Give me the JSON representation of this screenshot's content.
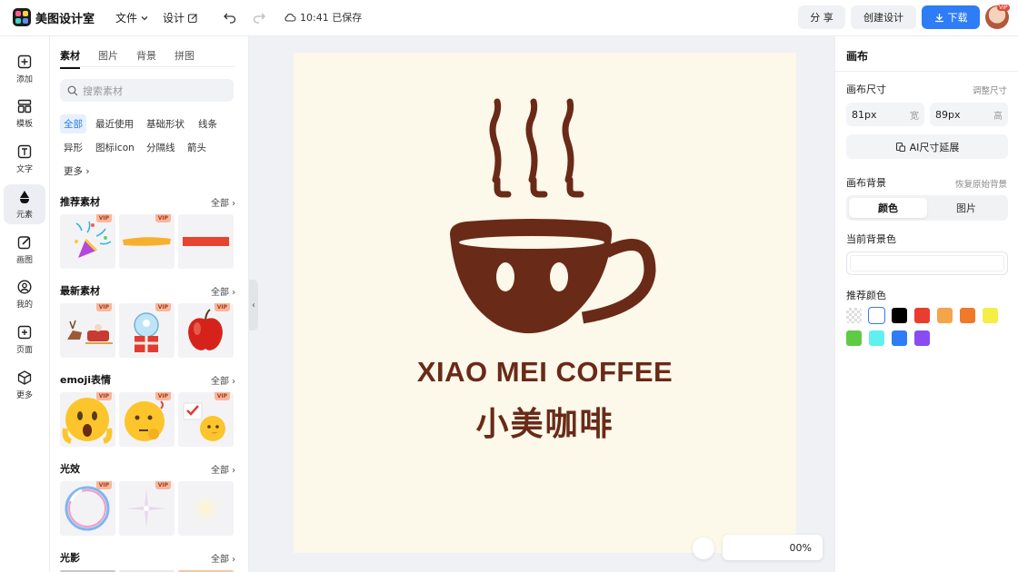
{
  "app": {
    "name": "美图设计室"
  },
  "topbar": {
    "file_menu": "文件",
    "design_menu": "设计",
    "save_status": "10:41 已保存",
    "share_label": "分 享",
    "create_label": "创建设计",
    "download_label": "下载",
    "avatar_badge": "VIP"
  },
  "rail": {
    "items": [
      {
        "label": "添加",
        "icon": "plus-square-icon"
      },
      {
        "label": "模板",
        "icon": "template-icon"
      },
      {
        "label": "文字",
        "icon": "text-icon"
      },
      {
        "label": "元素",
        "icon": "shapes-icon"
      },
      {
        "label": "画图",
        "icon": "pencil-icon"
      },
      {
        "label": "我的",
        "icon": "user-icon"
      },
      {
        "label": "页面",
        "icon": "page-add-icon"
      },
      {
        "label": "更多",
        "icon": "cube-icon"
      }
    ],
    "active": "元素"
  },
  "panel": {
    "tabs": [
      "素材",
      "图片",
      "背景",
      "拼图"
    ],
    "active_tab": "素材",
    "search_placeholder": "搜索素材",
    "chips": [
      "全部",
      "最近使用",
      "基础形状",
      "线条",
      "异形",
      "图标icon",
      "分隔线",
      "箭头",
      "更多"
    ],
    "vip_label": "VIP",
    "all_label": "全部",
    "sections": [
      {
        "title": "推荐素材",
        "items": [
          "party-popper",
          "yellow-brush-stroke",
          "red-bar"
        ]
      },
      {
        "title": "最新素材",
        "items": [
          "reindeer-sleigh",
          "snow-globe-gift",
          "red-apple"
        ]
      },
      {
        "title": "emoji表情",
        "items": [
          "shocked-emoji",
          "thinking-emoji",
          "chick-emoji"
        ]
      },
      {
        "title": "光效",
        "items": [
          "bubble-ring",
          "star-sparkle",
          "soft-glow"
        ]
      },
      {
        "title": "光影",
        "items": []
      }
    ]
  },
  "canvas": {
    "brand_en": "XIAO MEI COFFEE",
    "brand_cn": "小美咖啡",
    "background": "#fcf8ea",
    "logo_color": "#6a2a18",
    "zoom": "00%"
  },
  "right_panel": {
    "title": "画布",
    "size_label": "画布尺寸",
    "resize_link": "调整尺寸",
    "width_value": "81px",
    "width_unit": "宽",
    "height_value": "89px",
    "height_unit": "高",
    "ai_extend_label": "AI尺寸延展",
    "bg_label": "画布背景",
    "restore_link": "恢复原始背景",
    "seg_color": "颜色",
    "seg_image": "图片",
    "current_bg_label": "当前背景色",
    "recommended_label": "推荐颜色",
    "swatches": [
      "transparent",
      "#ffffff",
      "#000000",
      "#ea3d2f",
      "#f4a54a",
      "#ee7a2c",
      "#f5ee45",
      "#5fcb44",
      "#5ff0ef",
      "#2e7cf6",
      "#8a4cf0"
    ]
  },
  "colors": {
    "accent": "#2e7cf6",
    "brown": "#6a2a18"
  }
}
